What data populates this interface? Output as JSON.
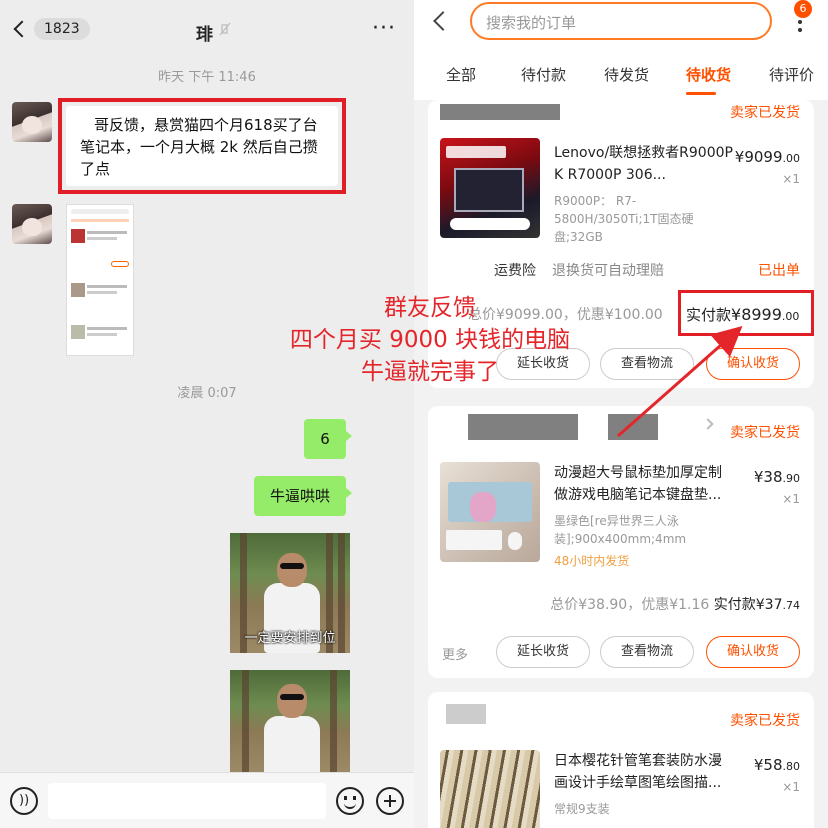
{
  "chat": {
    "back_count": "1823",
    "title": "琲",
    "timestamp_1": "昨天 下午 11:46",
    "message_1": "哥反馈，悬赏猫四个月618买了台笔记本，一个月大概 2k 然后自己攒了点",
    "timestamp_2": "凌晨 0:07",
    "reply_1": "6",
    "reply_2": "牛逼哄哄",
    "sticker_caption_1": "一定要安排到位"
  },
  "orders": {
    "search_placeholder": "搜索我的订单",
    "notif_count": "6",
    "tabs": [
      "全部",
      "待付款",
      "待发货",
      "待收货",
      "待评价"
    ],
    "active_tab": "待收货",
    "items": [
      {
        "status": "卖家已发货",
        "name": "Lenovo/联想拯救者R9000P K R7000P 306...",
        "spec": "R9000P： R7-5800H/3050Ti;1T固态硬盘;32GB",
        "price_int": "¥9099",
        "price_dec": ".00",
        "qty": "×1",
        "extra_label": "运费险",
        "extra_desc": "退换货可自动理赔",
        "extra_status": "已出单",
        "total_label": "总价",
        "total": "¥9099.00",
        "discount_label": "优惠",
        "discount": "¥100.00",
        "paid_label": "实付款",
        "paid_int": "¥8999",
        "paid_dec": ".00",
        "btn_extend": "延长收货",
        "btn_logistics": "查看物流",
        "btn_confirm": "确认收货"
      },
      {
        "status": "卖家已发货",
        "name": "动漫超大号鼠标垫加厚定制做游戏电脑笔记本键盘垫...",
        "spec": "墨绿色[re异世界三人泳装];900x400mm;4mm",
        "ship_note": "48小时内发货",
        "price_int": "¥38",
        "price_dec": ".90",
        "qty": "×1",
        "total_label": "总价",
        "total": "¥38.90",
        "discount_label": "优惠",
        "discount": "¥1.16",
        "paid_label": "实付款",
        "paid_int": "¥37",
        "paid_dec": ".74",
        "more": "更多",
        "btn_extend": "延长收货",
        "btn_logistics": "查看物流",
        "btn_confirm": "确认收货"
      },
      {
        "status": "卖家已发货",
        "name": "日本樱花针管笔套装防水漫画设计手绘草图笔绘图描...",
        "spec": "常规9支装",
        "price_int": "¥58",
        "price_dec": ".80",
        "qty": "×1"
      }
    ]
  },
  "annotation": {
    "line1": "群友反馈",
    "line2": "四个月买 9000 块钱的电脑",
    "line3": "牛逼就完事了"
  },
  "colors": {
    "accent": "#ff5000",
    "annotation_red": "#e4262b",
    "wechat_green": "#95ec69"
  }
}
